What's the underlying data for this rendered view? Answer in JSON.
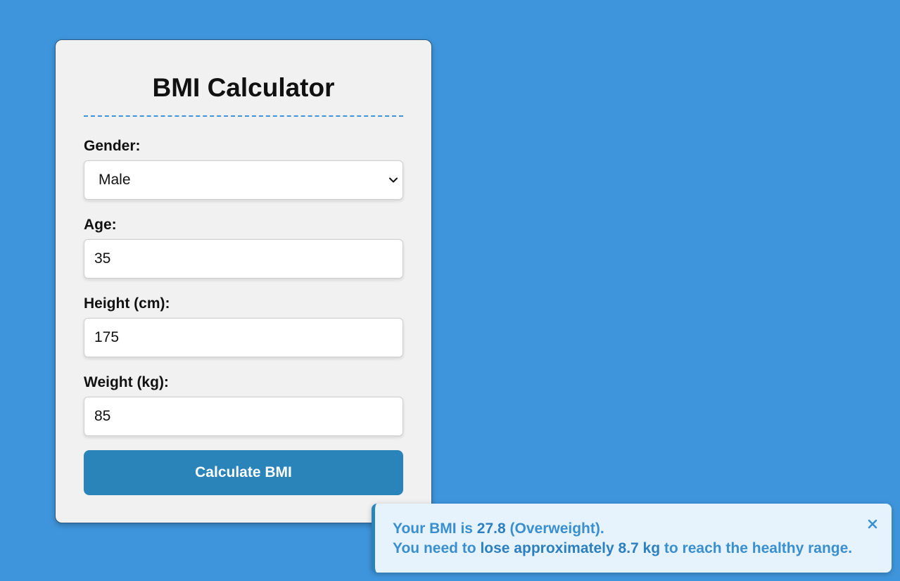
{
  "form": {
    "title": "BMI Calculator",
    "gender": {
      "label": "Gender:",
      "value": "Male"
    },
    "age": {
      "label": "Age:",
      "value": "35"
    },
    "height": {
      "label": "Height (cm):",
      "value": "175"
    },
    "weight": {
      "label": "Weight (kg):",
      "value": "85"
    },
    "submit_label": "Calculate BMI"
  },
  "result": {
    "line1_prefix": "Your BMI is ",
    "bmi_value": "27.8",
    "category": " (Overweight).",
    "line2_prefix": "You need to ",
    "line2_action": "lose approximately 8.7 kg",
    "line2_suffix": " to reach the healthy range."
  },
  "icons": {
    "select_chevron": "chevron-down-icon",
    "toast_close": "close-icon"
  },
  "colors": {
    "background": "#3f95dc",
    "accent": "#2a84ba",
    "card": "#f1f1f1",
    "toast_bg": "#e6f3fc",
    "toast_text": "#3a8fd0"
  }
}
